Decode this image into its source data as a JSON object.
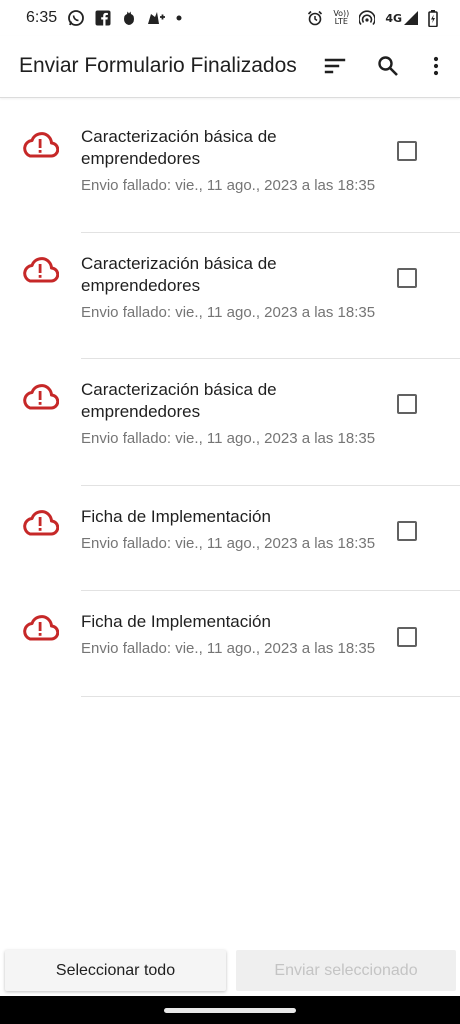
{
  "status_bar": {
    "time": "6:35",
    "volte_label": "Vo))",
    "lte_label": "LTE",
    "network_label": "4G"
  },
  "app_bar": {
    "title": "Enviar Formulario Finalizados",
    "actions": [
      "sort-icon",
      "search-icon",
      "more-vert-icon"
    ]
  },
  "forms": [
    {
      "title": "Caracterización básica de emprendedores",
      "status": "Envio fallado: vie., 11 ago., 2023 a las 18:35",
      "checked": false
    },
    {
      "title": "Caracterización básica de emprendedores",
      "status": "Envio fallado: vie., 11 ago., 2023 a las 18:35",
      "checked": false
    },
    {
      "title": "Caracterización básica de emprendedores",
      "status": "Envio fallado: vie., 11 ago., 2023 a las 18:35",
      "checked": false
    },
    {
      "title": "Ficha de Implementación",
      "status": "Envio fallado: vie., 11 ago., 2023 a las 18:35",
      "checked": false
    },
    {
      "title": "Ficha de Implementación",
      "status": "Envio fallado: vie., 11 ago., 2023 a las 18:35",
      "checked": false
    }
  ],
  "buttons": {
    "select_all": "Seleccionar todo",
    "send_selected": "Enviar seleccionado"
  },
  "colors": {
    "error_icon": "#c62828",
    "accent_text": "#1f1f1f",
    "secondary_text": "#757575",
    "disabled_text": "#c4c4c4"
  }
}
